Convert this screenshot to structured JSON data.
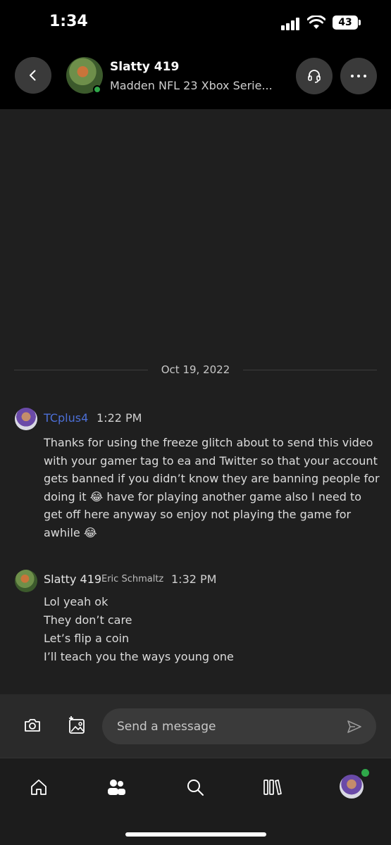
{
  "status_bar": {
    "time": "1:34",
    "battery": "43"
  },
  "header": {
    "name": "Slatty 419",
    "subtitle": "Madden NFL 23 Xbox Serie..."
  },
  "conversation": {
    "date_divider": "Oct 19, 2022",
    "messages": [
      {
        "sender": "TCplus4",
        "time": "1:22 PM",
        "text": "Thanks for using the freeze glitch about to send this video with your gamer tag to ea and Twitter so that your account gets banned if you didn’t know they are banning people for doing it 😂 have for playing another game also I need to get off here anyway so enjoy not playing the game for awhile 😂",
        "name_color": "#4c6fd6"
      },
      {
        "sender": "Slatty 419",
        "real_name": "Eric Schmaltz",
        "time": "1:32 PM",
        "lines": [
          "Lol yeah ok",
          "They don’t care",
          "Let’s flip a coin",
          "I’ll teach you the ways young one"
        ]
      }
    ]
  },
  "composer": {
    "placeholder": "Send a message"
  },
  "nav": {
    "items": [
      "home-icon",
      "social-icon",
      "search-icon",
      "library-icon",
      "profile-avatar"
    ]
  },
  "colors": {
    "background": "#1f1f1f",
    "header": "#000000",
    "accent_name": "#4c6fd6",
    "online": "#2fa84a"
  }
}
